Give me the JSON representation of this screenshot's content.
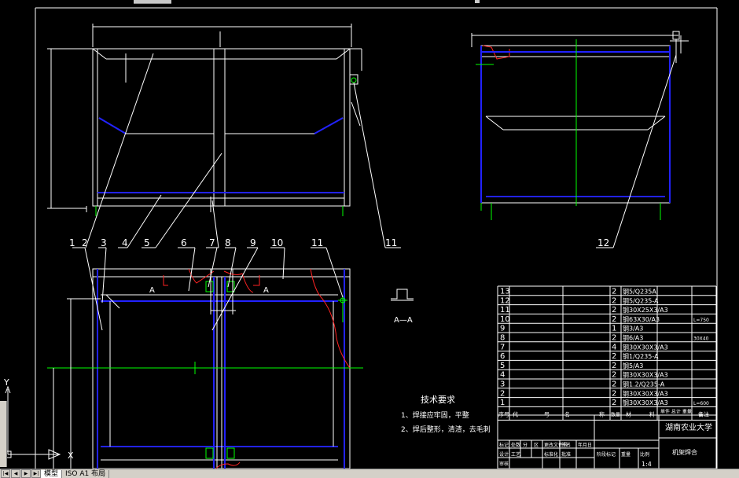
{
  "tabs": [
    "模型",
    "ISO A1 布局"
  ],
  "active_tab": 0,
  "balloons": [
    "1",
    "2",
    "3",
    "4",
    "5",
    "6",
    "7",
    "8",
    "9",
    "10",
    "11",
    "11",
    "12"
  ],
  "section_label_a": "A",
  "section_title": "A—A",
  "tech_title": "技术要求",
  "tech_notes": [
    "1、焊接应牢固，平整",
    "2、焊后整形，清渣，去毛刺"
  ],
  "ucs": {
    "x": "X",
    "y": "Y"
  },
  "bom_rows": [
    {
      "no": "13",
      "qty": "2",
      "mat": "钢5/Q235A",
      "note": ""
    },
    {
      "no": "12",
      "qty": "2",
      "mat": "钢5/Q235-A",
      "note": ""
    },
    {
      "no": "11",
      "qty": "2",
      "mat": "钢30X25X3/A3",
      "note": ""
    },
    {
      "no": "10",
      "qty": "2",
      "mat": "钢63X30/A3",
      "note": "L=750"
    },
    {
      "no": "9",
      "qty": "1",
      "mat": "钢3/A3",
      "note": ""
    },
    {
      "no": "8",
      "qty": "2",
      "mat": "钢6/A3",
      "note": "30X40"
    },
    {
      "no": "7",
      "qty": "4",
      "mat": "钢30X30X3/A3",
      "note": ""
    },
    {
      "no": "6",
      "qty": "2",
      "mat": "钢1/Q235-A",
      "note": ""
    },
    {
      "no": "5",
      "qty": "2",
      "mat": "钢5/A3",
      "note": ""
    },
    {
      "no": "4",
      "qty": "2",
      "mat": "钢30X30X3/A3",
      "note": ""
    },
    {
      "no": "3",
      "qty": "2",
      "mat": "钢1.2/Q235-A",
      "note": ""
    },
    {
      "no": "2",
      "qty": "2",
      "mat": "钢30X30X3/A3",
      "note": ""
    },
    {
      "no": "1",
      "qty": "2",
      "mat": "钢30X30X3/A3",
      "note": "L=600"
    }
  ],
  "bom_header": [
    "序号",
    "代",
    "号",
    "名",
    "称",
    "数量",
    "材",
    "料",
    "单件 总计 重量",
    "备注"
  ],
  "school": "湖南农业大学",
  "part_name": "机架焊合",
  "scale": "1:4",
  "title_small": [
    "标记",
    "处数",
    "分",
    "区",
    "更改文件号",
    "签名",
    "年月日",
    "设计",
    "审核",
    "工艺",
    "标准化",
    "批准",
    "阶段标记",
    "重量",
    "比例"
  ]
}
